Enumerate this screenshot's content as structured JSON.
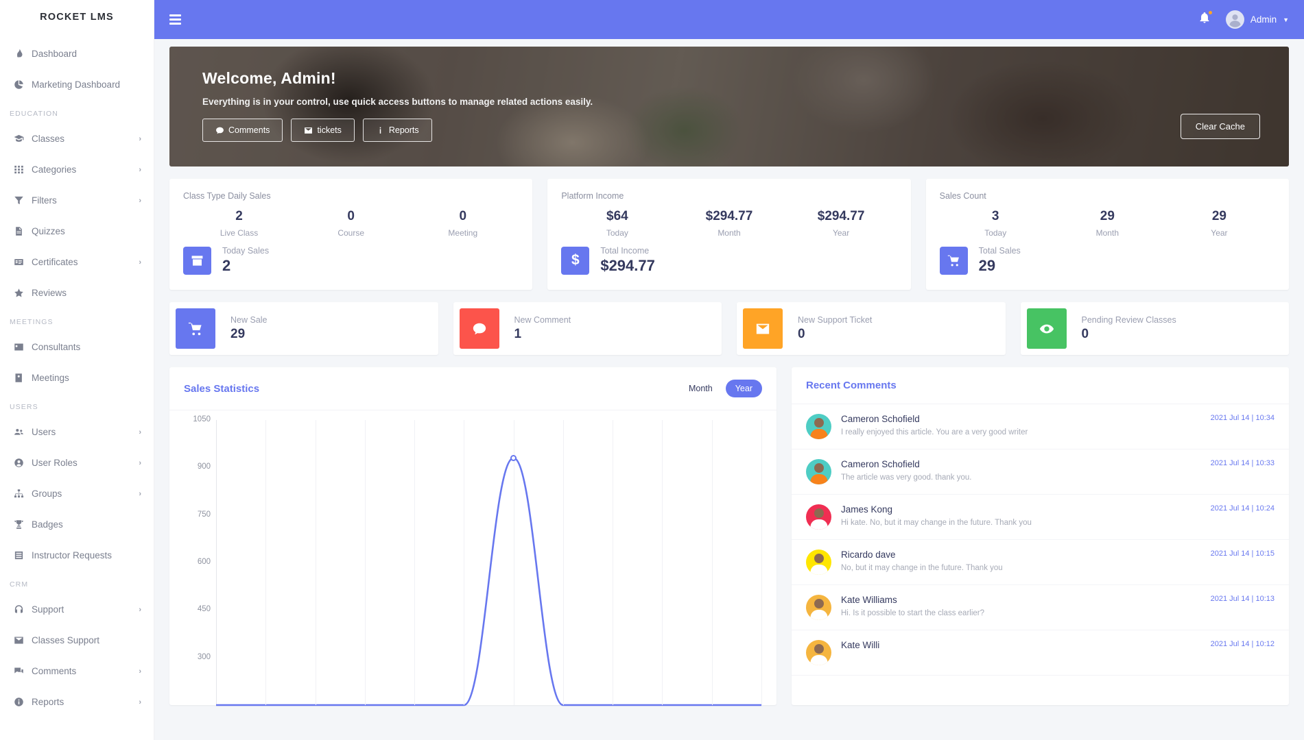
{
  "brand": "ROCKET LMS",
  "sidebar": {
    "groups": [
      {
        "label": "",
        "items": [
          {
            "label": "Dashboard",
            "icon": "fire-icon",
            "caret": false
          },
          {
            "label": "Marketing Dashboard",
            "icon": "pie-chart-icon",
            "caret": false
          }
        ]
      },
      {
        "label": "EDUCATION",
        "items": [
          {
            "label": "Classes",
            "icon": "graduation-cap-icon",
            "caret": true
          },
          {
            "label": "Categories",
            "icon": "grid-icon",
            "caret": true
          },
          {
            "label": "Filters",
            "icon": "funnel-icon",
            "caret": true
          },
          {
            "label": "Quizzes",
            "icon": "file-icon",
            "caret": false
          },
          {
            "label": "Certificates",
            "icon": "certificate-icon",
            "caret": true
          },
          {
            "label": "Reviews",
            "icon": "star-icon",
            "caret": false
          }
        ]
      },
      {
        "label": "MEETINGS",
        "items": [
          {
            "label": "Consultants",
            "icon": "id-card-icon",
            "caret": false
          },
          {
            "label": "Meetings",
            "icon": "address-book-icon",
            "caret": false
          }
        ]
      },
      {
        "label": "USERS",
        "items": [
          {
            "label": "Users",
            "icon": "users-icon",
            "caret": true
          },
          {
            "label": "User Roles",
            "icon": "user-circle-icon",
            "caret": true
          },
          {
            "label": "Groups",
            "icon": "sitemap-icon",
            "caret": true
          },
          {
            "label": "Badges",
            "icon": "trophy-icon",
            "caret": false
          },
          {
            "label": "Instructor Requests",
            "icon": "list-icon",
            "caret": false
          }
        ]
      },
      {
        "label": "CRM",
        "items": [
          {
            "label": "Support",
            "icon": "headset-icon",
            "caret": true
          },
          {
            "label": "Classes Support",
            "icon": "envelope-icon",
            "caret": false
          },
          {
            "label": "Comments",
            "icon": "comments-icon",
            "caret": true
          },
          {
            "label": "Reports",
            "icon": "info-circle-icon",
            "caret": true
          }
        ]
      }
    ]
  },
  "topbar": {
    "menu_icon": "hamburger-icon",
    "bell_icon": "bell-icon",
    "user_name": "Admin",
    "avatar_icon": "user-avatar-icon",
    "caret_icon": "chevron-down-icon"
  },
  "banner": {
    "title": "Welcome, Admin!",
    "subtitle": "Everything is in your control, use quick access buttons to manage related actions easily.",
    "buttons": [
      {
        "label": "Comments",
        "icon": "comment-icon"
      },
      {
        "label": "tickets",
        "icon": "envelope-icon"
      },
      {
        "label": "Reports",
        "icon": "info-icon"
      }
    ],
    "clear_cache": "Clear Cache"
  },
  "stat_cards": [
    {
      "title": "Class Type Daily Sales",
      "triples": [
        {
          "value": "2",
          "label": "Live Class"
        },
        {
          "value": "0",
          "label": "Course"
        },
        {
          "value": "0",
          "label": "Meeting"
        }
      ],
      "footer_label": "Today Sales",
      "footer_value": "2",
      "icon": "archive-box-icon",
      "color": "#6777ef"
    },
    {
      "title": "Platform Income",
      "triples": [
        {
          "value": "$64",
          "label": "Today"
        },
        {
          "value": "$294.77",
          "label": "Month"
        },
        {
          "value": "$294.77",
          "label": "Year"
        }
      ],
      "footer_label": "Total Income",
      "footer_value": "$294.77",
      "icon": "dollar-sign-icon",
      "color": "#6777ef"
    },
    {
      "title": "Sales Count",
      "triples": [
        {
          "value": "3",
          "label": "Today"
        },
        {
          "value": "29",
          "label": "Month"
        },
        {
          "value": "29",
          "label": "Year"
        }
      ],
      "footer_label": "Total Sales",
      "footer_value": "29",
      "icon": "shopping-cart-icon",
      "color": "#6777ef"
    }
  ],
  "tiles": [
    {
      "label": "New Sale",
      "value": "29",
      "icon": "shopping-cart-icon",
      "color": "#6777ef"
    },
    {
      "label": "New Comment",
      "value": "1",
      "icon": "comment-icon",
      "color": "#fc544b"
    },
    {
      "label": "New Support Ticket",
      "value": "0",
      "icon": "envelope-icon",
      "color": "#ffa426"
    },
    {
      "label": "Pending Review Classes",
      "value": "0",
      "icon": "eye-icon",
      "color": "#47c363"
    }
  ],
  "sales_statistics": {
    "title": "Sales Statistics",
    "toggle": [
      {
        "label": "Month",
        "active": false
      },
      {
        "label": "Year",
        "active": true
      }
    ]
  },
  "chart_data": {
    "type": "line",
    "title": "Sales Statistics",
    "xlabel": "",
    "ylabel": "",
    "ylim": [
      150,
      1050
    ],
    "yticks": [
      1050,
      900,
      750,
      600,
      450,
      300
    ],
    "grid": true,
    "legend": false,
    "x": [
      1,
      2,
      3,
      4,
      5,
      6,
      7,
      8,
      9,
      10,
      11,
      12
    ],
    "series": [
      {
        "name": "Sales",
        "color": "#6777ef",
        "values": [
          150,
          150,
          150,
          150,
          150,
          150,
          930,
          150,
          150,
          150,
          150,
          150
        ]
      }
    ],
    "markers": [
      {
        "x": 7,
        "y": 930
      }
    ]
  },
  "recent_comments": {
    "title": "Recent Comments",
    "items": [
      {
        "name": "Cameron Schofield",
        "text": "I really enjoyed this article. You are a very good writer",
        "time": "2021 Jul 14 | 10:34",
        "bg": "#4ecdc4",
        "shirt": "#f7821b"
      },
      {
        "name": "Cameron Schofield",
        "text": "The article was very good. thank you.",
        "time": "2021 Jul 14 | 10:33",
        "bg": "#4ecdc4",
        "shirt": "#f7821b"
      },
      {
        "name": "James Kong",
        "text": "Hi kate. No, but it may change in the future. Thank you",
        "time": "2021 Jul 14 | 10:24",
        "bg": "#f02e52",
        "shirt": "#ffffff"
      },
      {
        "name": "Ricardo dave",
        "text": "No, but it may change in the future. Thank you",
        "time": "2021 Jul 14 | 10:15",
        "bg": "#ffe600",
        "shirt": "#ffffff"
      },
      {
        "name": "Kate Williams",
        "text": "Hi. Is it possible to start the class earlier?",
        "time": "2021 Jul 14 | 10:13",
        "bg": "#f5b53f",
        "shirt": "#ffffff"
      },
      {
        "name": "Kate Willi",
        "text": "",
        "time": "2021 Jul 14 | 10:12",
        "bg": "#f5b53f",
        "shirt": "#ffffff"
      }
    ]
  }
}
